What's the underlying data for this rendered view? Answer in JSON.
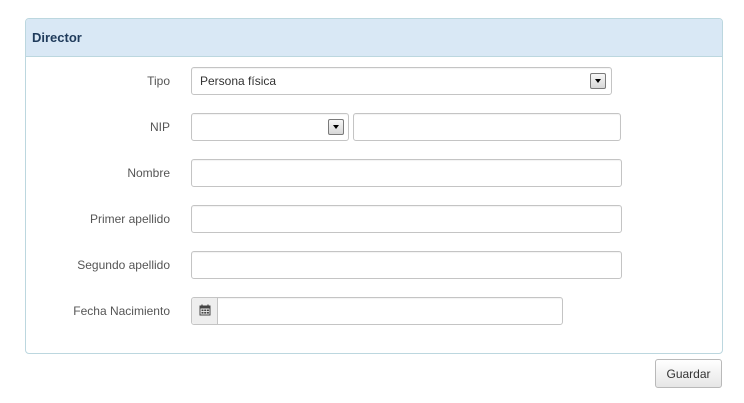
{
  "panel": {
    "title": "Director"
  },
  "form": {
    "tipo": {
      "label": "Tipo",
      "selected": "Persona física"
    },
    "nip": {
      "label": "NIP",
      "type_selected": "",
      "value": ""
    },
    "nombre": {
      "label": "Nombre",
      "value": ""
    },
    "primer_apellido": {
      "label": "Primer apellido",
      "value": ""
    },
    "segundo_apellido": {
      "label": "Segundo apellido",
      "value": ""
    },
    "fecha_nacimiento": {
      "label": "Fecha Nacimiento",
      "value": "",
      "icon": "calendar-icon"
    }
  },
  "actions": {
    "save_label": "Guardar"
  }
}
